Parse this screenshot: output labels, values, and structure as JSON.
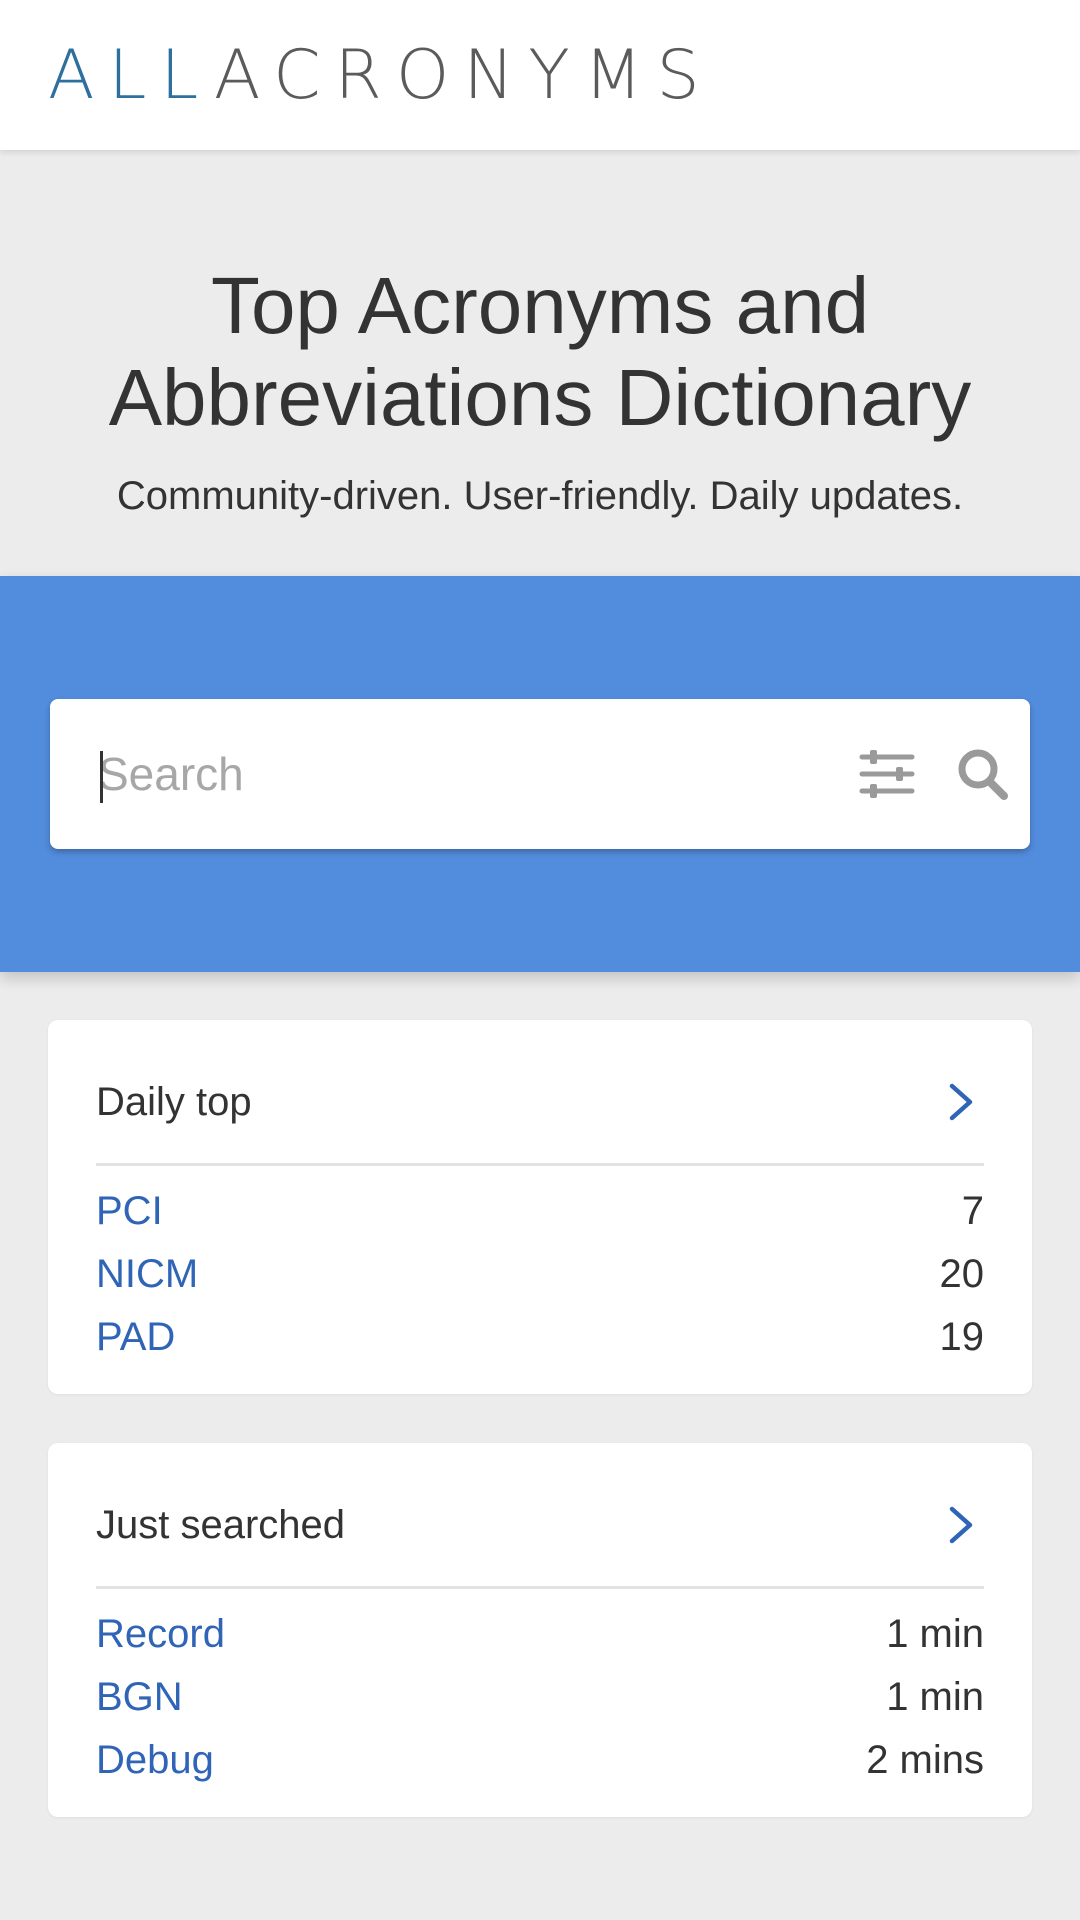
{
  "header": {
    "logo_part1": "ALL",
    "logo_part2": "ACRONYMS"
  },
  "hero": {
    "title": "Top Acronyms and Abbreviations Dictionary",
    "subtitle": "Community-driven. User-friendly. Daily updates."
  },
  "search": {
    "placeholder": "Search",
    "filter_icon": "sliders-icon",
    "search_icon": "magnifier-icon"
  },
  "colors": {
    "accent_band": "#528cdc",
    "link": "#2f64b6",
    "logo_blue": "#2e6f9e"
  },
  "daily_top": {
    "title": "Daily top",
    "items": [
      {
        "term": "PCI",
        "value": "7"
      },
      {
        "term": "NICM",
        "value": "20"
      },
      {
        "term": "PAD",
        "value": "19"
      }
    ]
  },
  "just_searched": {
    "title": "Just searched",
    "items": [
      {
        "term": "Record",
        "value": "1 min"
      },
      {
        "term": "BGN",
        "value": "1 min"
      },
      {
        "term": "Debug",
        "value": "2 mins"
      }
    ]
  }
}
